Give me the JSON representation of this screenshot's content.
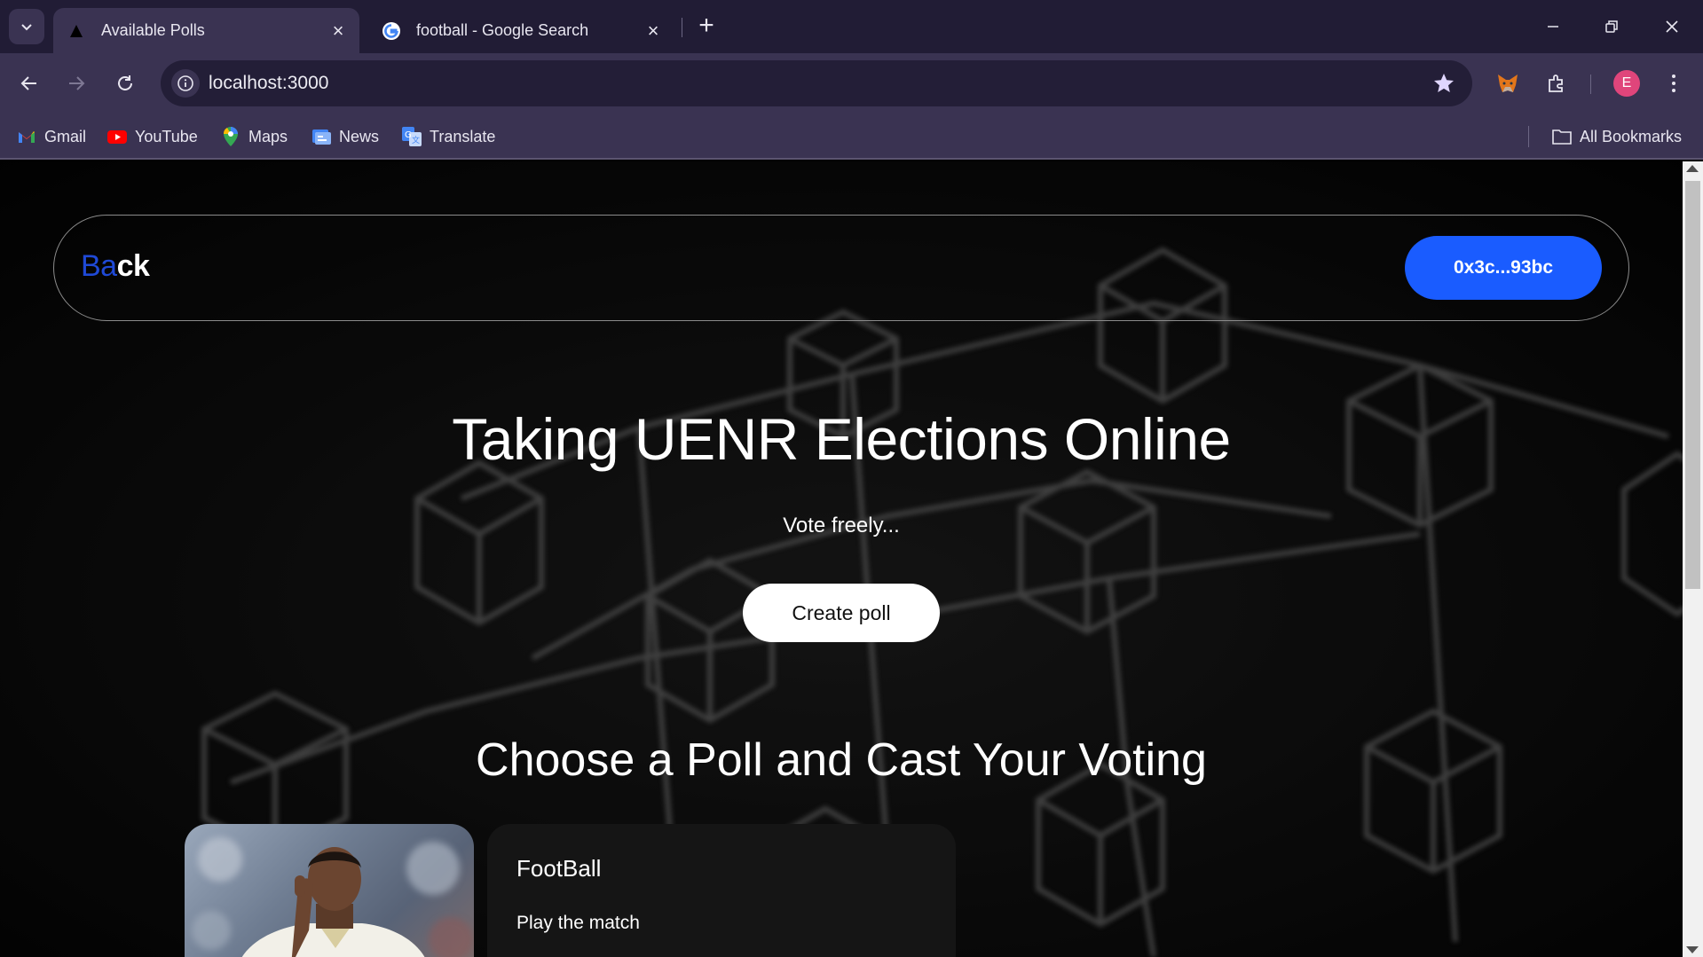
{
  "browser": {
    "tabs": [
      {
        "title": "Available Polls",
        "icon": "triangle-favicon",
        "active": true
      },
      {
        "title": "football - Google Search",
        "icon": "google-favicon",
        "active": false
      }
    ],
    "url": "localhost:3000",
    "profile_initial": "E",
    "bookmarks": [
      {
        "label": "Gmail",
        "icon": "gmail-icon"
      },
      {
        "label": "YouTube",
        "icon": "youtube-icon"
      },
      {
        "label": "Maps",
        "icon": "maps-icon"
      },
      {
        "label": "News",
        "icon": "news-icon"
      },
      {
        "label": "Translate",
        "icon": "translate-icon"
      }
    ],
    "all_bookmarks": "All Bookmarks"
  },
  "page": {
    "back_part1": "Ba",
    "back_part2": "ck",
    "wallet_address": "0x3c...93bc",
    "hero_title": "Taking UENR Elections Online",
    "hero_subtitle": "Vote freely...",
    "create_poll": "Create poll",
    "section_title": "Choose a Poll and Cast Your Voting",
    "polls": [
      {
        "title": "FootBall",
        "description": "Play the match"
      }
    ]
  },
  "colors": {
    "accent_blue": "#1a5cff",
    "back_blue": "#1f49d6",
    "chrome_dark": "#211c35",
    "chrome_mid": "#3a3352"
  }
}
